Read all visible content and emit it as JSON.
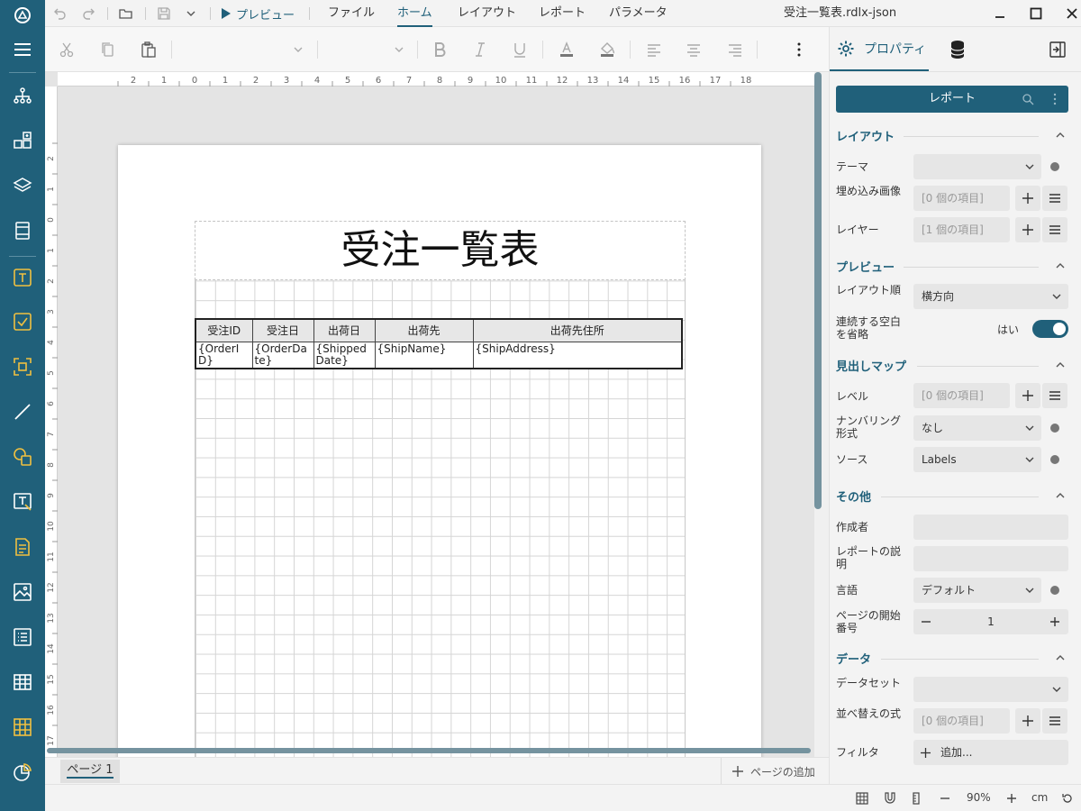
{
  "window": {
    "title": "受注一覧表.rdlx-json"
  },
  "titlebar": {
    "preview_label": "プレビュー",
    "menus": [
      "ファイル",
      "ホーム",
      "レイアウト",
      "レポート",
      "パラメータ"
    ],
    "active_menu": "ホーム"
  },
  "panel_tabs": {
    "properties_label": "プロパティ"
  },
  "rulers": {
    "horizontal": [
      "2",
      "1",
      "0",
      "1",
      "2",
      "3",
      "4",
      "5",
      "6",
      "7",
      "8",
      "9",
      "10",
      "11",
      "12",
      "13",
      "14",
      "15",
      "16",
      "17",
      "18"
    ],
    "vertical": [
      "2",
      "1",
      "0",
      "1",
      "2",
      "3",
      "4",
      "5",
      "6",
      "7",
      "8",
      "9",
      "10",
      "11",
      "12",
      "13",
      "14",
      "15",
      "16",
      "17"
    ]
  },
  "report": {
    "title": "受注一覧表",
    "table": {
      "headers": [
        "受注ID",
        "受注日",
        "出荷日",
        "出荷先",
        "出荷先住所"
      ],
      "cells": [
        "{OrderID}",
        "{OrderDate}",
        "{ShippedDate}",
        "{ShipName}",
        "{ShipAddress}"
      ]
    }
  },
  "pages": {
    "tab_label": "ページ 1",
    "add_label": "ページの追加"
  },
  "status": {
    "zoom": "90%",
    "unit": "cm"
  },
  "properties": {
    "header_label": "レポート",
    "sections": {
      "layout": "レイアウト",
      "preview": "プレビュー",
      "docmap": "見出しマップ",
      "other": "その他",
      "data": "データ"
    },
    "theme_label": "テーマ",
    "embedded_images_label": "埋め込み画像",
    "embedded_images_value": "[0 個の項目]",
    "layers_label": "レイヤー",
    "layers_value": "[1 個の項目]",
    "layout_order_label": "レイアウト順",
    "layout_order_value": "横方向",
    "consume_whitespace_label": "連続する空白を省略",
    "consume_whitespace_value": "はい",
    "levels_label": "レベル",
    "levels_value": "[0 個の項目]",
    "numbering_label": "ナンバリング形式",
    "numbering_value": "なし",
    "source_label": "ソース",
    "source_value": "Labels",
    "author_label": "作成者",
    "description_label": "レポートの説明",
    "language_label": "言語",
    "language_value": "デフォルト",
    "start_page_label": "ページの開始番号",
    "start_page_value": "1",
    "dataset_label": "データセット",
    "sort_label": "並べ替えの式",
    "sort_value": "[0 個の項目]",
    "filter_label": "フィルタ",
    "filter_value": "追加..."
  }
}
